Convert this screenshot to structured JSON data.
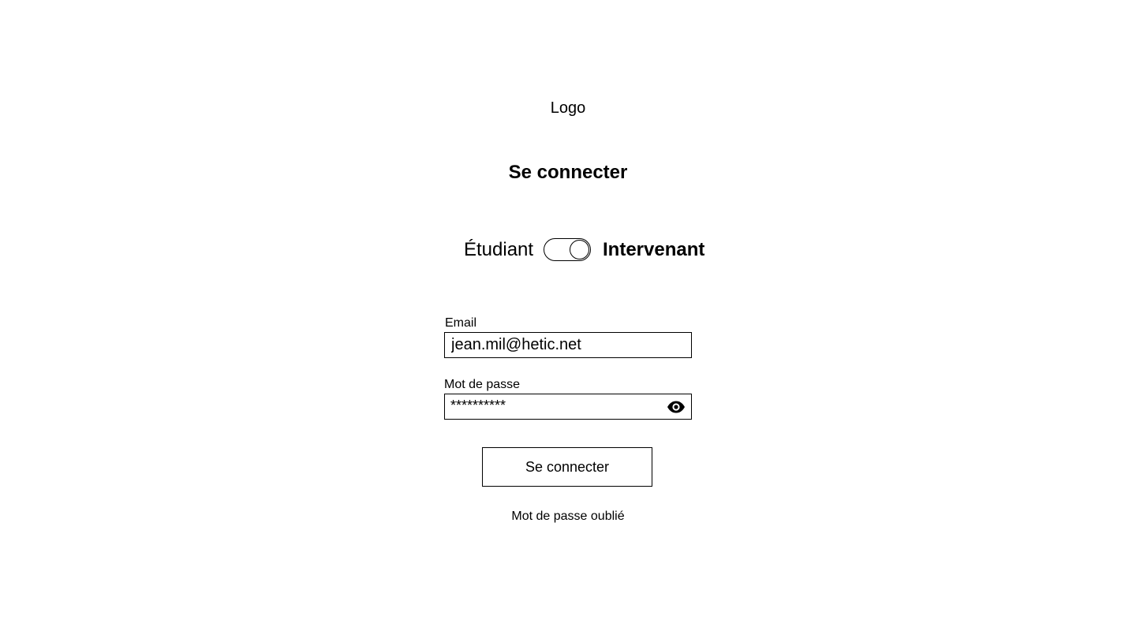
{
  "logo": "Logo",
  "title": "Se connecter",
  "role_toggle": {
    "left_label": "Étudiant",
    "right_label": "Intervenant",
    "selected": "Intervenant"
  },
  "email": {
    "label": "Email",
    "value": "jean.mil@hetic.net"
  },
  "password": {
    "label": "Mot de passe",
    "value": "**********",
    "toggle_icon": "eye-icon"
  },
  "submit_label": "Se connecter",
  "forgot_password": "Mot de passe oublié"
}
